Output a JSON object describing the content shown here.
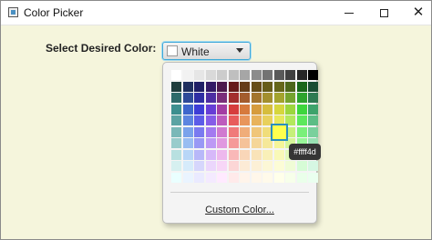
{
  "window": {
    "title": "Color Picker"
  },
  "prompt_label": "Select Desired Color:",
  "combo": {
    "selected_label": "White",
    "selected_color": "#ffffff"
  },
  "palette": {
    "hovered_color": "#ffff4d",
    "tooltip": "#ffff4d",
    "custom_link": "Custom Color...",
    "rows": [
      [
        "#ffffff",
        "#f2f2f2",
        "#e6e6e6",
        "#d9d9d9",
        "#cccccc",
        "#bfbfbf",
        "#a6a6a6",
        "#8c8c8c",
        "#737373",
        "#595959",
        "#404040",
        "#262626",
        "#000000"
      ],
      [
        "#1f3d3d",
        "#1f2f5f",
        "#1f1f66",
        "#331a66",
        "#4d1a4d",
        "#661a1a",
        "#663d1a",
        "#664d1a",
        "#665c1a",
        "#66661a",
        "#4d661a",
        "#1a661a",
        "#1a4d33"
      ],
      [
        "#2e6b6b",
        "#2e4a99",
        "#2e2ea3",
        "#4d2ea3",
        "#7a2e7a",
        "#a32e2e",
        "#a35c2e",
        "#a3752e",
        "#a38f2e",
        "#a3a32e",
        "#75a32e",
        "#2ea32e",
        "#2e7a52"
      ],
      [
        "#3d8f8f",
        "#3d66cc",
        "#3d3dd6",
        "#663dd6",
        "#a33da3",
        "#d63d3d",
        "#d67a3d",
        "#d69c3d",
        "#d6bd3d",
        "#d6d63d",
        "#9cd63d",
        "#3dd63d",
        "#3da36b"
      ],
      [
        "#5ca3a3",
        "#5c85e0",
        "#5c5ce8",
        "#855ce8",
        "#bd5cbd",
        "#e85c5c",
        "#e8965c",
        "#e8b35c",
        "#e8d05c",
        "#e8e85c",
        "#b3e85c",
        "#5ce85c",
        "#5cbd85"
      ],
      [
        "#7ab8b8",
        "#7aa3eb",
        "#7a7af0",
        "#a37af0",
        "#d07ad0",
        "#f07a7a",
        "#f0ad7a",
        "#f0c67a",
        "#f0dd7a",
        "#ffff4d",
        "#c6f07a",
        "#7af07a",
        "#7ad09c"
      ],
      [
        "#99cccc",
        "#99bdf2",
        "#9999f5",
        "#bd99f5",
        "#e099e0",
        "#f59999",
        "#f5c299",
        "#f5d699",
        "#f5e899",
        "#f5f599",
        "#d6f599",
        "#99f599",
        "#99e0b3"
      ],
      [
        "#b8e0e0",
        "#b8d6f7",
        "#b8b8f9",
        "#d6b8f9",
        "#edb8ed",
        "#f9b8b8",
        "#f9d6b8",
        "#f9e3b8",
        "#f9f0b8",
        "#f9f9b8",
        "#e3f9b8",
        "#b8f9b8",
        "#b8edcc"
      ],
      [
        "#d6f0f0",
        "#d6ebfb",
        "#d6d6fc",
        "#ebd6fc",
        "#f7d6f7",
        "#fcd6d6",
        "#fcebd6",
        "#fcf0d6",
        "#fcf7d6",
        "#fcfcd6",
        "#f0fcd6",
        "#d6fcd6",
        "#d6f7e3"
      ],
      [
        "#eaffff",
        "#eaf4ff",
        "#eaeaff",
        "#f4eaff",
        "#ffeaff",
        "#ffeaea",
        "#fff4ea",
        "#fff7ea",
        "#fffaea",
        "#ffffea",
        "#f7ffea",
        "#eaffea",
        "#eaffef"
      ]
    ]
  }
}
